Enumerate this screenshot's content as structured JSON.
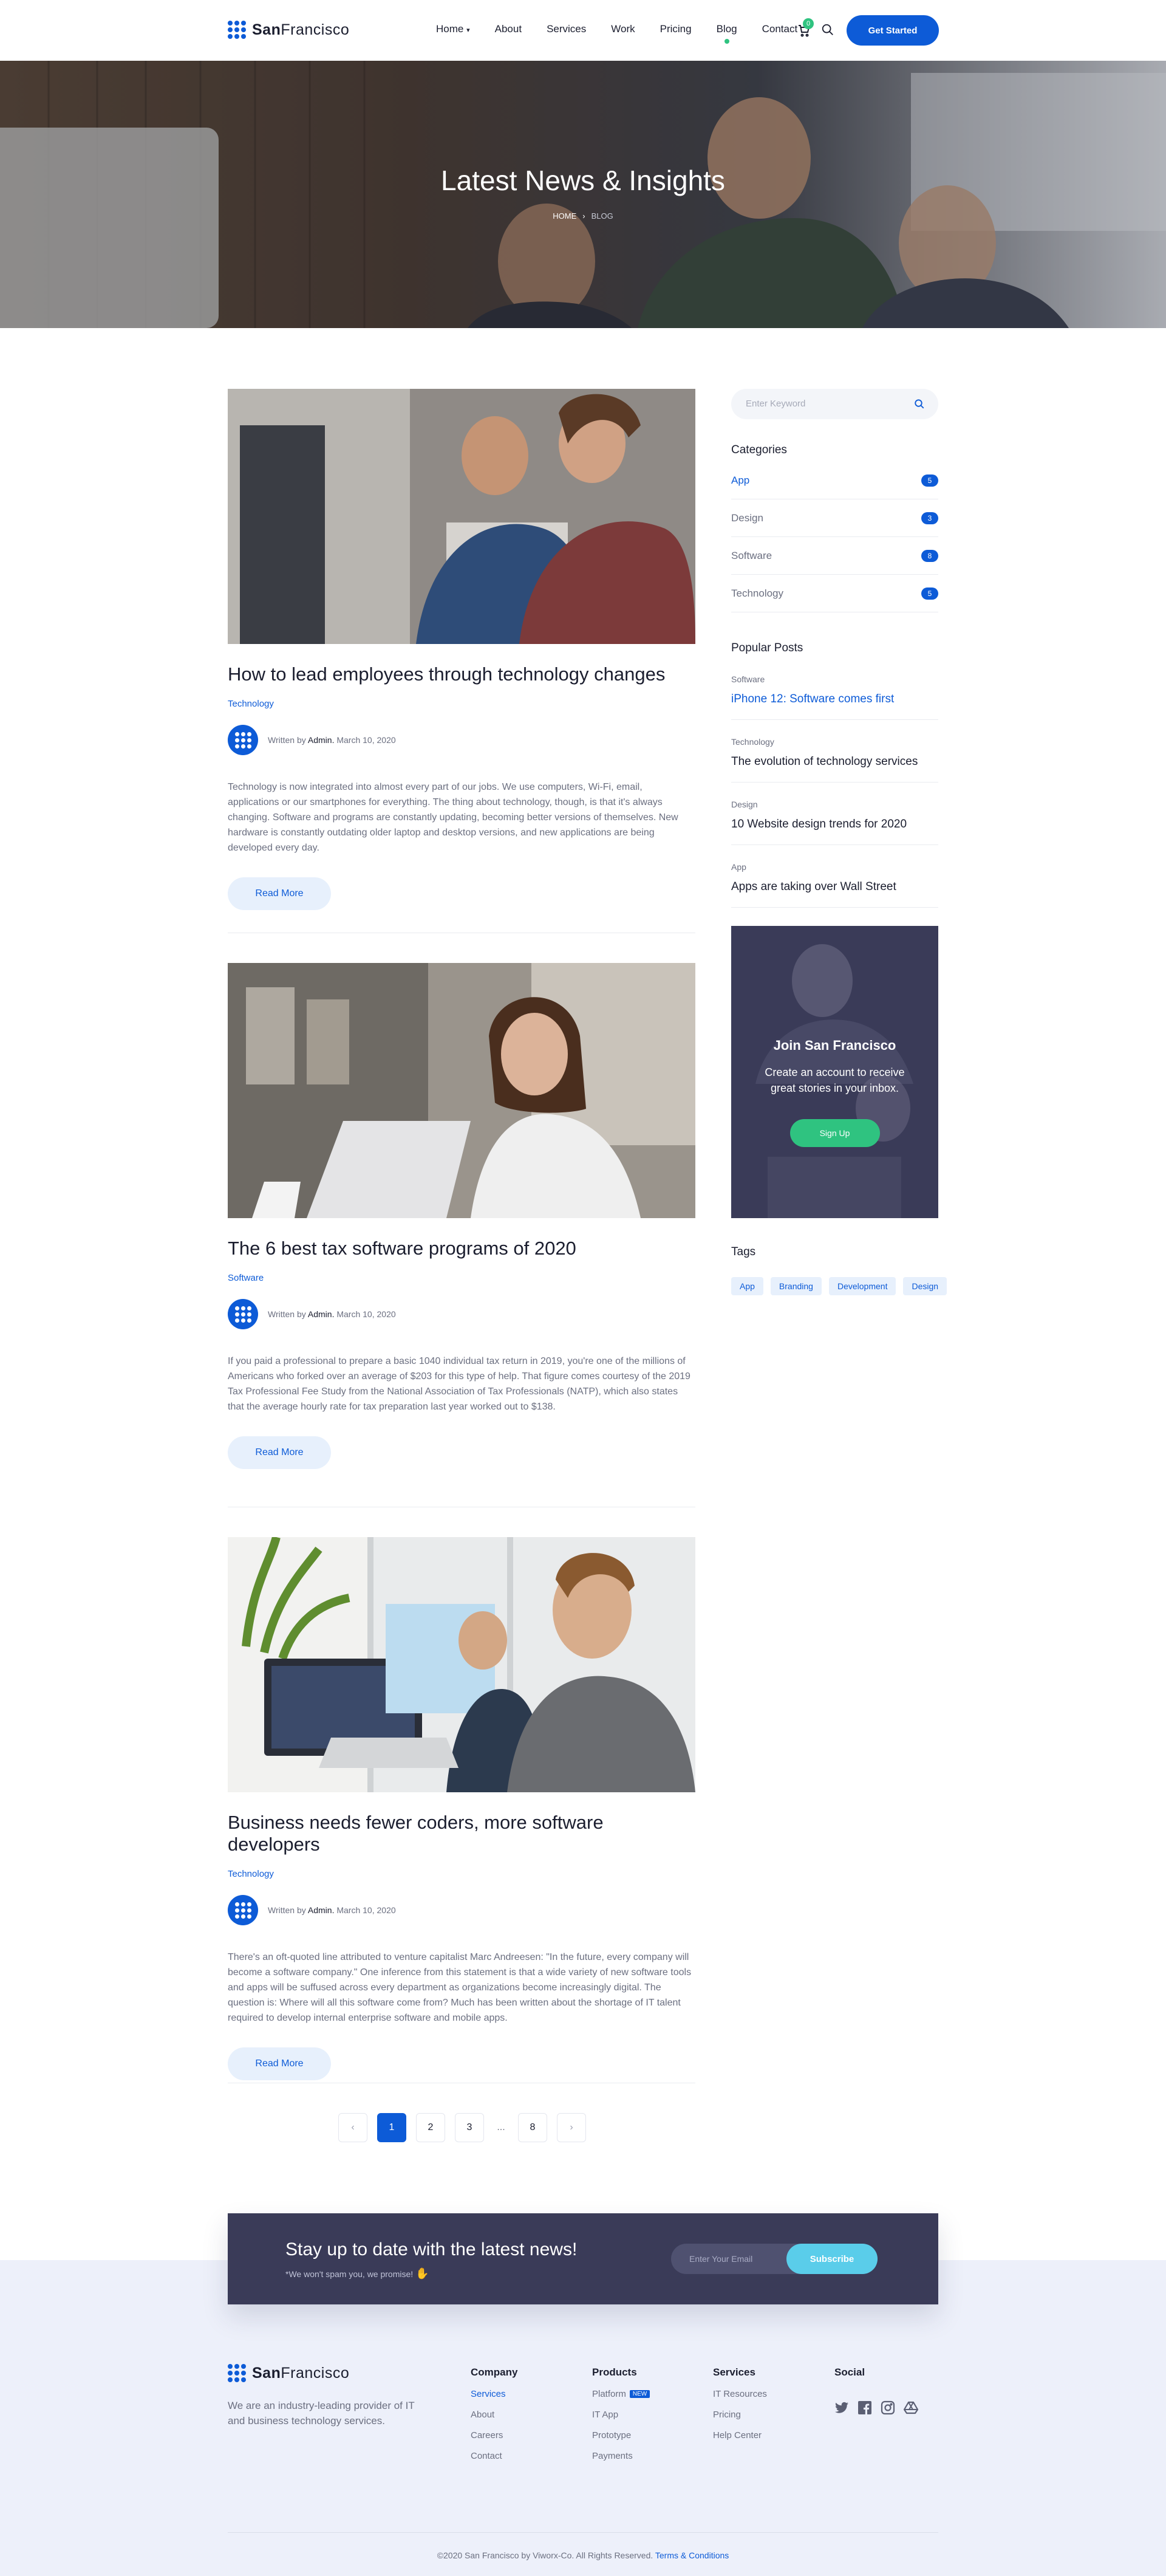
{
  "brand": {
    "name_bold": "San",
    "name_rest": "Francisco"
  },
  "nav": {
    "items": [
      "Home",
      "About",
      "Services",
      "Work",
      "Pricing",
      "Blog",
      "Contact"
    ],
    "cart_count": "0",
    "cta": "Get Started"
  },
  "hero": {
    "title": "Latest News & Insights",
    "crumb_home": "HOME",
    "crumb_current": "BLOG"
  },
  "posts": [
    {
      "title": "How to lead employees through technology changes",
      "category": "Technology",
      "written_by": "Written by",
      "author": "Admin.",
      "date": "March 10, 2020",
      "excerpt": "Technology is now integrated into almost every part of our jobs. We use computers, Wi-Fi, email, applications or our smartphones for everything. The thing about technology, though, is that it's always changing. Software and programs are constantly updating, becoming better versions of themselves. New hardware is constantly outdating older laptop and desktop versions, and new applications are being developed every day.",
      "cta": "Read More"
    },
    {
      "title": "The 6 best tax software programs of 2020",
      "category": "Software",
      "written_by": "Written by",
      "author": "Admin.",
      "date": "March 10, 2020",
      "excerpt": "If you paid a professional to prepare a basic 1040 individual tax return in 2019, you're one of the millions of Americans who forked over an average of $203 for this type of help. That figure comes courtesy of the 2019 Tax Professional Fee Study from the National Association of Tax Professionals (NATP), which also states that the average hourly rate for tax preparation last year worked out to $138.",
      "cta": "Read More"
    },
    {
      "title": "Business needs fewer coders, more software developers",
      "category": "Technology",
      "written_by": "Written by",
      "author": "Admin.",
      "date": "March 10, 2020",
      "excerpt": "There's an oft-quoted line attributed to venture capitalist Marc Andreesen: \"In the future, every company will become a software company.\" One inference from this statement is that a wide variety of new software tools and apps will be suffused across every department as organizations become increasingly digital. The question is: Where will all this software come from? Much has been written about the shortage of IT talent required to develop internal enterprise software and mobile apps.",
      "cta": "Read More"
    }
  ],
  "pagination": {
    "prev": "‹",
    "pages": [
      "1",
      "2",
      "3"
    ],
    "dots": "...",
    "last": "8",
    "next": "›",
    "current": "1"
  },
  "sidebar": {
    "search_placeholder": "Enter Keyword",
    "categories_title": "Categories",
    "categories": [
      {
        "name": "App",
        "count": "5"
      },
      {
        "name": "Design",
        "count": "3"
      },
      {
        "name": "Software",
        "count": "8"
      },
      {
        "name": "Technology",
        "count": "5"
      }
    ],
    "popular_title": "Popular Posts",
    "popular": [
      {
        "category": "Software",
        "title": "iPhone 12: Software comes first"
      },
      {
        "category": "Technology",
        "title": "The evolution of technology services"
      },
      {
        "category": "Design",
        "title": "10 Website design trends for 2020"
      },
      {
        "category": "App",
        "title": "Apps are taking over Wall Street"
      }
    ],
    "join": {
      "title": "Join San Francisco",
      "text": "Create an account to receive great stories in your inbox.",
      "cta": "Sign Up"
    },
    "tags_title": "Tags",
    "tags": [
      "App",
      "Branding",
      "Development",
      "Design"
    ]
  },
  "newsletter": {
    "title": "Stay up to date with the latest news!",
    "note": "*We won't spam you, we promise!",
    "placeholder": "Enter Your Email",
    "cta": "Subscribe"
  },
  "footer": {
    "description": "We are an industry-leading provider of IT and business technology services.",
    "company": {
      "title": "Company",
      "links": [
        "Services",
        "About",
        "Careers",
        "Contact"
      ]
    },
    "products": {
      "title": "Products",
      "links": [
        "Platform",
        "IT App",
        "Prototype",
        "Payments"
      ],
      "new_badge": "NEW"
    },
    "services": {
      "title": "Services",
      "links": [
        "IT Resources",
        "Pricing",
        "Help Center"
      ]
    },
    "social": {
      "title": "Social",
      "icons": [
        "twitter-icon",
        "facebook-icon",
        "instagram-icon",
        "google-drive-icon"
      ]
    },
    "copyright": "©2020 San Francisco by Viworx-Co. All Rights Reserved.",
    "terms": "Terms & Conditions"
  },
  "colors": {
    "primary": "#0d5bd7",
    "green": "#2fc380",
    "dark": "#3a3b58",
    "cyan": "#5acdea"
  }
}
